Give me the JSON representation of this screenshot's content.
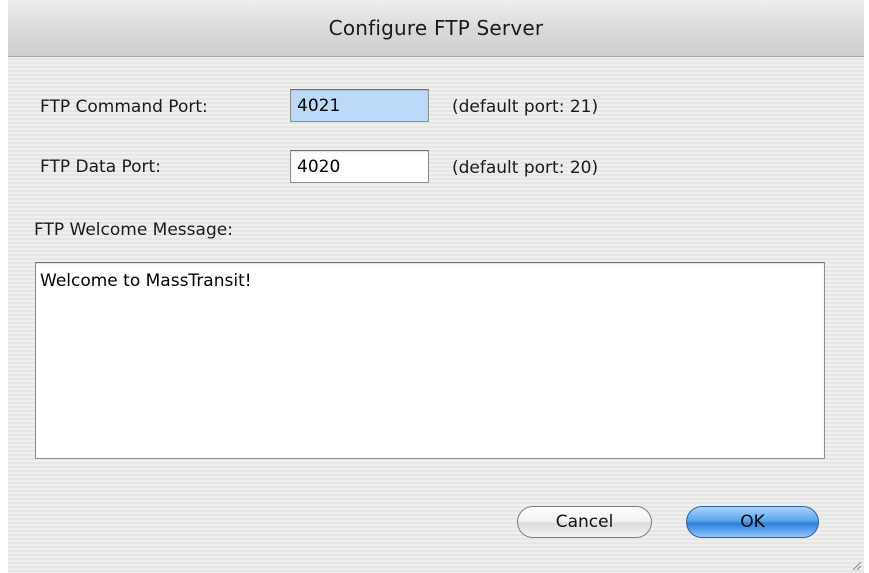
{
  "window": {
    "title": "Configure FTP Server"
  },
  "form": {
    "command_port": {
      "label": "FTP Command Port:",
      "value": "4021",
      "hint": "(default port: 21)"
    },
    "data_port": {
      "label": "FTP Data Port:",
      "value": "4020",
      "hint": "(default port: 20)"
    },
    "welcome": {
      "label": "FTP Welcome Message:",
      "value": "Welcome to MassTransit!"
    }
  },
  "buttons": {
    "cancel_label": "Cancel",
    "ok_label": "OK"
  },
  "colors": {
    "selection": "#bcd9f7",
    "ok_button": "#3b8ae6"
  }
}
